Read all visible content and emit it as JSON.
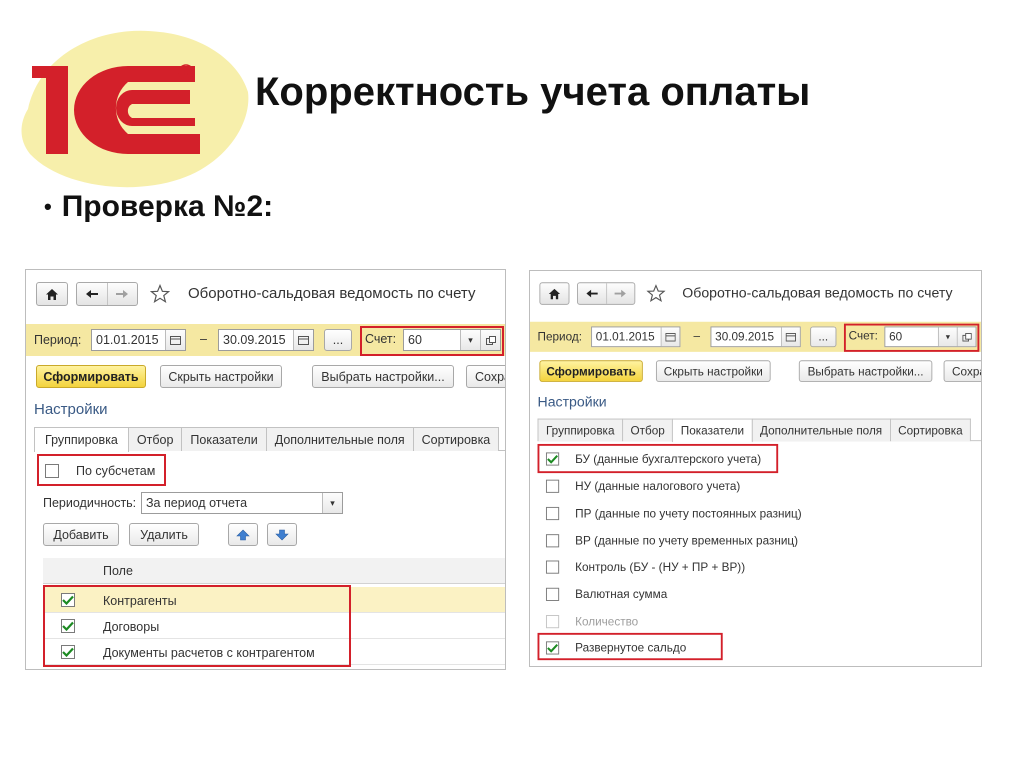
{
  "slide": {
    "title": "Корректность учета оплаты",
    "bullet": "Проверка №2:"
  },
  "colors": {
    "logo_red": "#d3202a",
    "logo_backdrop": "#f7efab",
    "period_bar": "#f5e8a2",
    "primary_button": "#f3d33d",
    "highlight": "#d3202a"
  },
  "left": {
    "window_title": "Оборотно-сальдовая ведомость по счету",
    "icons": {
      "home": "home-icon",
      "back": "arrow-left-icon",
      "forward": "arrow-right-icon",
      "favorite": "star-icon"
    },
    "period": {
      "label": "Период:",
      "from": "01.01.2015",
      "dash": "–",
      "to": "30.09.2015",
      "more": "..."
    },
    "account": {
      "label": "Счет:",
      "value": "60"
    },
    "buttons": {
      "generate": "Сформировать",
      "hide_settings": "Скрыть настройки",
      "choose_settings": "Выбрать настройки...",
      "save": "Сохра"
    },
    "settings_title": "Настройки",
    "tabs": [
      "Группировка",
      "Отбор",
      "Показатели",
      "Дополнительные поля",
      "Сортировка"
    ],
    "active_tab": "Группировка",
    "by_subaccounts": {
      "label": "По субсчетам",
      "checked": false
    },
    "periodicity": {
      "label": "Периодичность:",
      "value": "За период отчета"
    },
    "grid_buttons": {
      "add": "Добавить",
      "delete": "Удалить"
    },
    "grid_header": "Поле",
    "rows": [
      {
        "label": "Контрагенты",
        "checked": true
      },
      {
        "label": "Договоры",
        "checked": true
      },
      {
        "label": "Документы расчетов с контрагентом",
        "checked": true
      }
    ]
  },
  "right": {
    "window_title": "Оборотно-сальдовая ведомость по счету",
    "icons": {
      "home": "home-icon",
      "back": "arrow-left-icon",
      "forward": "arrow-right-icon",
      "favorite": "star-icon"
    },
    "period": {
      "label": "Период:",
      "from": "01.01.2015",
      "dash": "–",
      "to": "30.09.2015",
      "more": "..."
    },
    "account": {
      "label": "Счет:",
      "value": "60"
    },
    "buttons": {
      "generate": "Сформировать",
      "hide_settings": "Скрыть настройки",
      "choose_settings": "Выбрать настройки...",
      "save": "Сохра"
    },
    "settings_title": "Настройки",
    "tabs": [
      "Группировка",
      "Отбор",
      "Показатели",
      "Дополнительные поля",
      "Сортировка"
    ],
    "active_tab": "Показатели",
    "indicators": [
      {
        "label": "БУ (данные бухгалтерского учета)",
        "checked": true,
        "disabled": false
      },
      {
        "label": "НУ (данные налогового учета)",
        "checked": false,
        "disabled": false
      },
      {
        "label": "ПР (данные по учету постоянных разниц)",
        "checked": false,
        "disabled": false
      },
      {
        "label": "ВР (данные по учету временных разниц)",
        "checked": false,
        "disabled": false
      },
      {
        "label": "Контроль (БУ - (НУ + ПР + ВР))",
        "checked": false,
        "disabled": false
      },
      {
        "label": "Валютная сумма",
        "checked": false,
        "disabled": false
      },
      {
        "label": "Количество",
        "checked": false,
        "disabled": true
      },
      {
        "label": "Развернутое сальдо",
        "checked": true,
        "disabled": false
      }
    ]
  }
}
